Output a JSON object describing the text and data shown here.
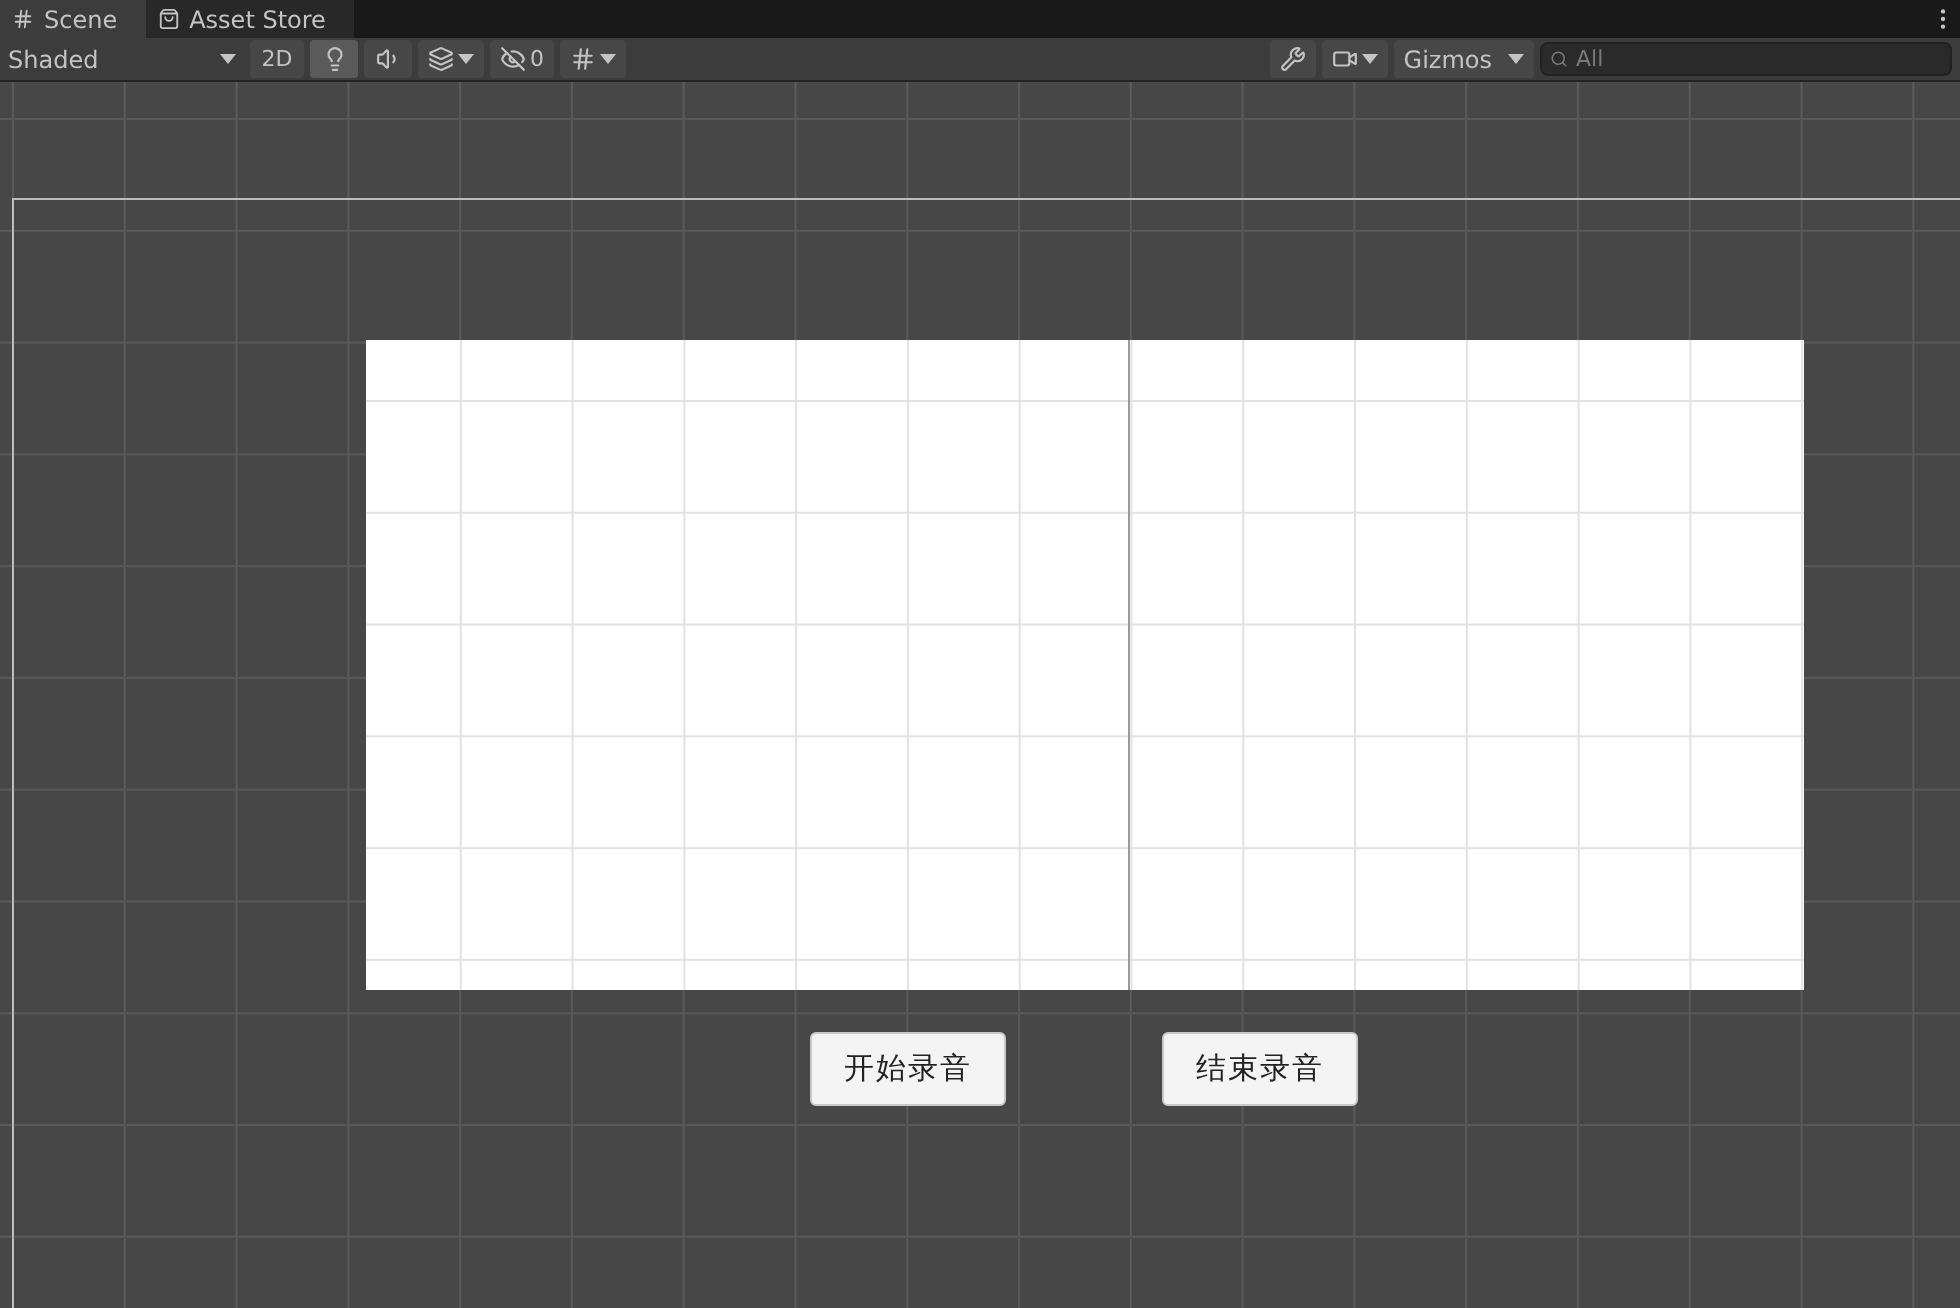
{
  "tabs": [
    {
      "label": "Scene",
      "kind": "grid",
      "selected": true
    },
    {
      "label": "Asset Store",
      "kind": "bag",
      "selected": false
    }
  ],
  "toolbar": {
    "draw_mode": "Shaded",
    "toggles": [
      {
        "kind": "text",
        "label": "2D",
        "on": false
      },
      {
        "kind": "light",
        "on": true
      },
      {
        "kind": "audio",
        "on": false
      },
      {
        "kind": "effects",
        "on": false
      }
    ],
    "hidden_count": "0",
    "gizmos": "Gizmos",
    "search": {
      "placeholder": "All"
    }
  },
  "scene": {
    "buttons": [
      {
        "label": "开始录音"
      },
      {
        "label": "结束录音"
      }
    ]
  }
}
